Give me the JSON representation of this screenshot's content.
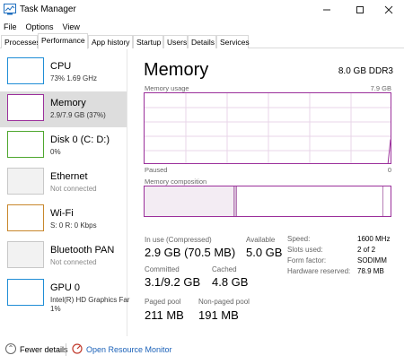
{
  "window": {
    "title": "Task Manager"
  },
  "menu": [
    "File",
    "Options",
    "View"
  ],
  "tabs": [
    "Processes",
    "Performance",
    "App history",
    "Startup",
    "Users",
    "Details",
    "Services"
  ],
  "sidebar": [
    {
      "name": "CPU",
      "sub": "73%  1.69 GHz",
      "color": "#1f8dd6"
    },
    {
      "name": "Memory",
      "sub": "2.9/7.9 GB (37%)",
      "color": "#9b2f9b"
    },
    {
      "name": "Disk 0 (C: D:)",
      "sub": "0%",
      "color": "#4ea72e"
    },
    {
      "name": "Ethernet",
      "sub": "Not connected",
      "color": "#b0b0b0"
    },
    {
      "name": "Wi-Fi",
      "sub": "S: 0  R: 0 Kbps",
      "color": "#c8872c"
    },
    {
      "name": "Bluetooth PAN",
      "sub": "Not connected",
      "color": "#b0b0b0"
    },
    {
      "name": "GPU 0",
      "sub": "Intel(R) HD Graphics Far",
      "sub2": "1%",
      "color": "#1f8dd6"
    }
  ],
  "main": {
    "title": "Memory",
    "total": "8.0 GB DDR3",
    "usage_label": "Memory usage",
    "usage_max": "7.9 GB",
    "paused": "Paused",
    "zero": "0",
    "composition_label": "Memory composition",
    "accent": "#9b2f9b"
  },
  "stats": {
    "in_use_label": "In use (Compressed)",
    "in_use": "2.9 GB (70.5 MB)",
    "available_label": "Available",
    "available": "5.0 GB",
    "committed_label": "Committed",
    "committed": "3.1/9.2 GB",
    "cached_label": "Cached",
    "cached": "4.8 GB",
    "paged_label": "Paged pool",
    "paged": "211 MB",
    "nonpaged_label": "Non-paged pool",
    "nonpaged": "191 MB"
  },
  "details": [
    {
      "label": "Speed:",
      "value": "1600 MHz"
    },
    {
      "label": "Slots used:",
      "value": "2 of 2"
    },
    {
      "label": "Form factor:",
      "value": "SODIMM"
    },
    {
      "label": "Hardware reserved:",
      "value": "78.9 MB"
    }
  ],
  "footer": {
    "fewer": "Fewer details",
    "monitor": "Open Resource Monitor"
  }
}
